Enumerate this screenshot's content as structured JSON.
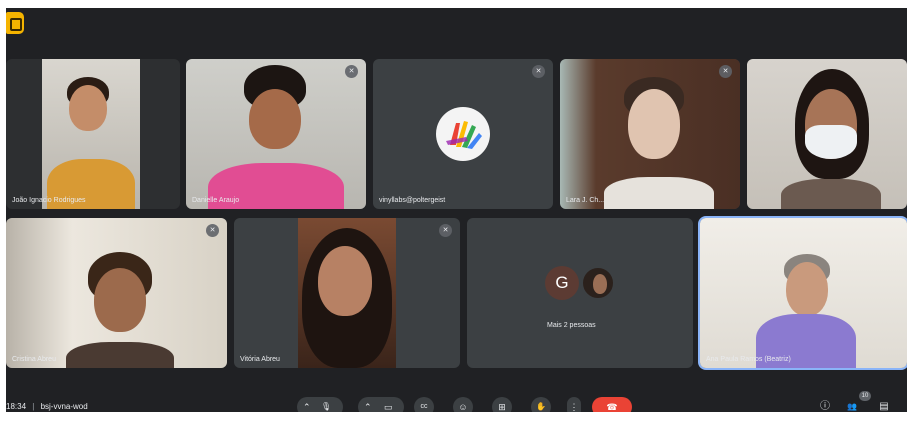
{
  "participants": [
    {
      "name": "João Ignacio Rodrigues",
      "muted": false
    },
    {
      "name": "Danielle Araujo",
      "muted": true
    },
    {
      "name": "vinyllabs@poltergeist",
      "muted": true
    },
    {
      "name": "Lara J. Ch...",
      "muted": true
    },
    {
      "name": "",
      "muted": false
    },
    {
      "name": "Cristina Abreu",
      "muted": true
    },
    {
      "name": "Vitória Abreu",
      "muted": true
    },
    {
      "name": "Ana Paula Ramos (Beatriz)",
      "muted": false
    }
  ],
  "more": {
    "initial": "G",
    "label": "Mais 2 pessoas"
  },
  "bottom_bar": {
    "time": "18:34",
    "separator": "|",
    "meeting_code": "bsj-vvna-wod"
  },
  "controls": {
    "mic_chevron": "⌃",
    "mic_icon": "🎙",
    "cam_chevron": "⌃",
    "cam_icon": "▭",
    "captions_icon": "cc",
    "emoji_icon": "☺",
    "present_icon": "⊞",
    "hand_icon": "✋",
    "more_icon": "⋮",
    "hangup_icon": "☎"
  },
  "right_controls": {
    "info_icon": "ⓘ",
    "people_icon": "👥",
    "people_count": "10",
    "chat_icon": "▤"
  },
  "colors": {
    "background": "#202124",
    "tile": "#3c4043",
    "hangup": "#ea4335",
    "active_border": "#8ab4f8",
    "logo": "#f5b400"
  }
}
